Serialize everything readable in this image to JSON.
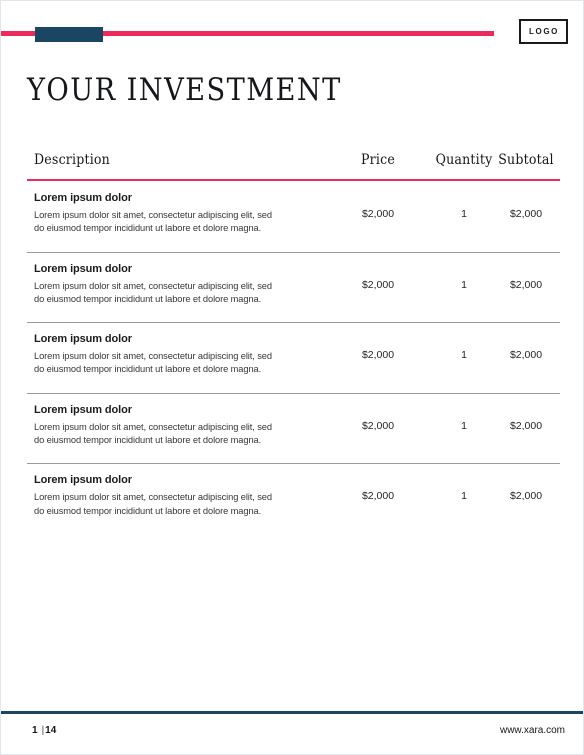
{
  "header": {
    "logo_label": "LOGO",
    "accent_line_color": "#ec2b5b",
    "block_color": "#1a4663"
  },
  "title": "YOUR INVESTMENT",
  "table": {
    "columns": {
      "description": "Description",
      "price": "Price",
      "quantity": "Quantity",
      "subtotal": "Subtotal"
    },
    "header_rule_color": "#ec2b5b",
    "row_separator_color": "#9a9a9a",
    "rows": [
      {
        "title": "Lorem ipsum dolor",
        "body": "Lorem ipsum dolor sit amet, consectetur adipiscing elit, sed do eiusmod tempor incididunt ut labore et dolore magna.",
        "price": "$2,000",
        "quantity": "1",
        "subtotal": "$2,000"
      },
      {
        "title": "Lorem ipsum dolor",
        "body": "Lorem ipsum dolor sit amet, consectetur adipiscing elit, sed do eiusmod tempor incididunt ut labore et dolore magna.",
        "price": "$2,000",
        "quantity": "1",
        "subtotal": "$2,000"
      },
      {
        "title": "Lorem ipsum dolor",
        "body": "Lorem ipsum dolor sit amet, consectetur adipiscing elit, sed do eiusmod tempor incididunt ut labore et dolore magna.",
        "price": "$2,000",
        "quantity": "1",
        "subtotal": "$2,000"
      },
      {
        "title": "Lorem ipsum dolor",
        "body": "Lorem ipsum dolor sit amet, consectetur adipiscing elit, sed do eiusmod tempor incididunt ut labore et dolore magna.",
        "price": "$2,000",
        "quantity": "1",
        "subtotal": "$2,000"
      },
      {
        "title": "Lorem ipsum dolor",
        "body": "Lorem ipsum dolor sit amet, consectetur adipiscing elit, sed do eiusmod tempor incididunt ut labore et dolore magna.",
        "price": "$2,000",
        "quantity": "1",
        "subtotal": "$2,000"
      }
    ]
  },
  "footer": {
    "page_number": "1",
    "page_separator": "|",
    "page_total": "14",
    "website": "www.xara.com",
    "rule_color": "#1a4663"
  }
}
